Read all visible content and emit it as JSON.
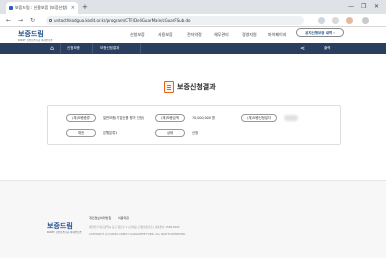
{
  "browser": {
    "tab_title": "보증드림 : 신용보증 (보증신청)",
    "tab_close": "×",
    "new_tab": "+",
    "window_controls": [
      "—",
      "❐",
      "✕"
    ],
    "nav_buttons": [
      "←",
      "→",
      "↻"
    ],
    "url": "untacthkodgua.kodit.or.kr/program/CTF/DeliGuarMain/cGuarFSub.do"
  },
  "site": {
    "logo": "보증드림",
    "logo_sub": "KODIT 신용보증기금 비대면보증",
    "nav": [
      "신청보증",
      "사용보증",
      "전자약정",
      "채무관리",
      "경영지원",
      "마이페이지"
    ],
    "notice_button": "공지신청보증 내역 ›"
  },
  "subnav": {
    "home_icon": "⌂",
    "breadcrumb_1": "신청보증",
    "breadcrumb_2": "보증신청결과",
    "share_icon": "⋖",
    "print_label": "출력"
  },
  "page": {
    "title": "보증신청결과"
  },
  "result": {
    "row1": [
      {
        "label": "(재)보증종류",
        "value": "일반보증(기업신용 평가 인정)"
      },
      {
        "label": "(재)보증금액",
        "value": "70,000,000 원"
      },
      {
        "label": "(재)보증신청일자",
        "value": ""
      }
    ],
    "row2": [
      {
        "label": "채권",
        "value": "은행분류1"
      },
      {
        "label": "상태",
        "value": "신청"
      }
    ]
  },
  "footer": {
    "links": [
      "개인정보처리방침",
      "이용약관"
    ],
    "logo": "보증드림",
    "logo_sub": "KODIT 신용보증기금 비대면보증",
    "address": "대한민국 대구광역시 동구 첨단로 7 (신서동) 신용보증기금 | 대표번호 1588-6565",
    "copyright": "COPYRIGHT (C) KOREA CREDIT GUARANTEE FUND. ALL RIGHTS RESERVED."
  }
}
